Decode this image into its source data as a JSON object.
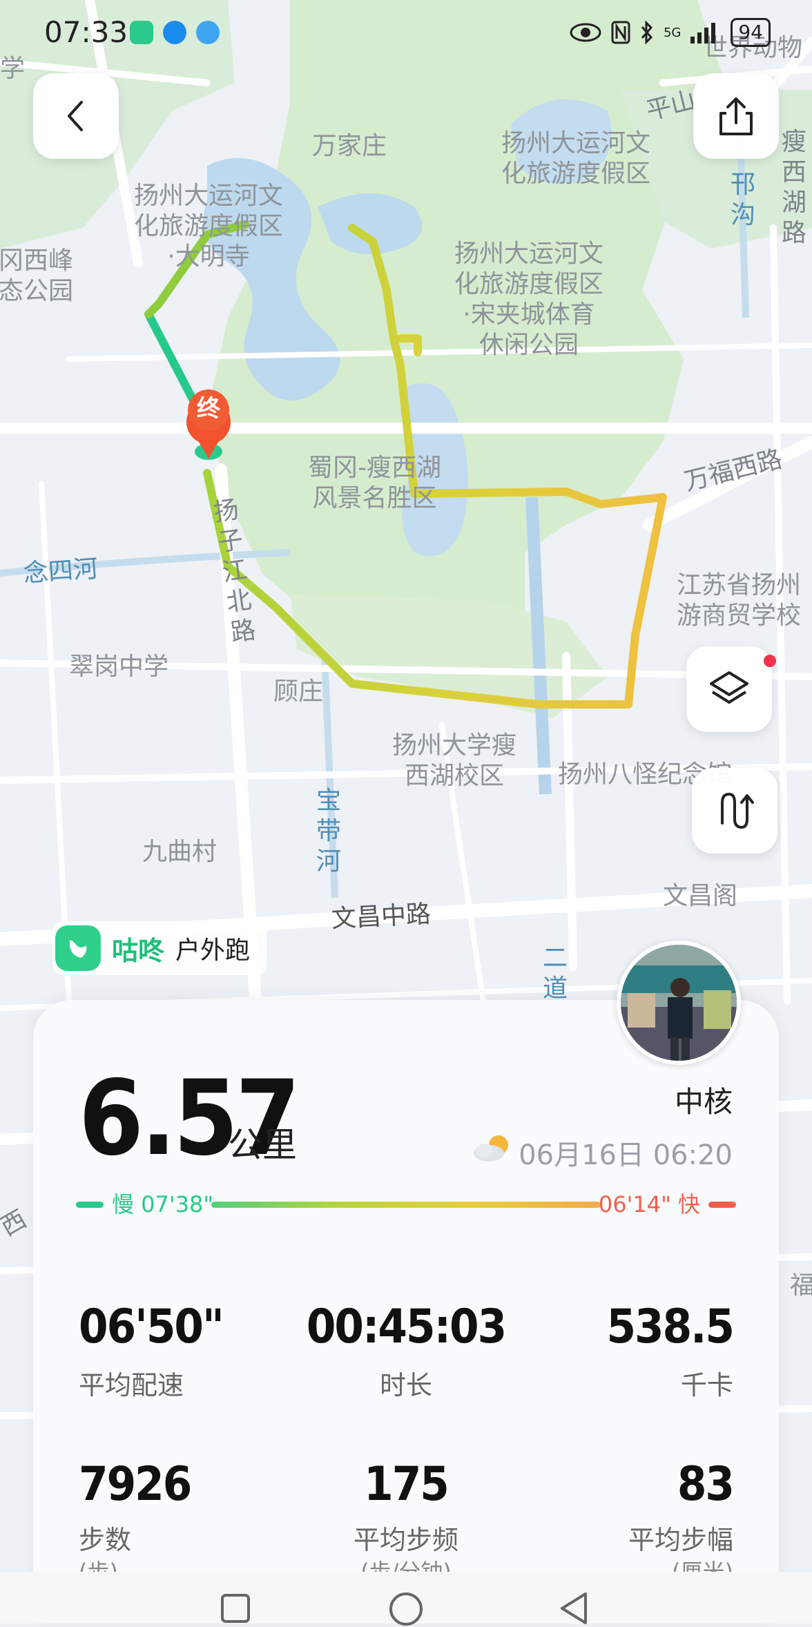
{
  "status_bar": {
    "time": "07:33",
    "battery": "94",
    "network": "5G"
  },
  "map": {
    "labels": [
      {
        "text": "万家庄",
        "kind": "place"
      },
      {
        "text": "扬州大运河文\n化旅游度假区",
        "kind": "place"
      },
      {
        "text": "扬州大运河文\n化旅游度假区\n·大明寺",
        "kind": "place"
      },
      {
        "text": "扬州大运河文\n化旅游度假区\n·宋夹城体育\n休闲公园",
        "kind": "place"
      },
      {
        "text": "冈西峰\n态公园",
        "kind": "place"
      },
      {
        "text": "蜀冈-瘦西湖\n风景名胜区",
        "kind": "place"
      },
      {
        "text": "万福西路",
        "kind": "road"
      },
      {
        "text": "念四河",
        "kind": "water"
      },
      {
        "text": "邗\n沟",
        "kind": "water"
      },
      {
        "text": "瘦\n西\n湖\n路",
        "kind": "road"
      },
      {
        "text": "平山",
        "kind": "road"
      },
      {
        "text": "扬子江北路",
        "kind": "road"
      },
      {
        "text": "翠岗中学",
        "kind": "place"
      },
      {
        "text": "顾庄",
        "kind": "place"
      },
      {
        "text": "江苏省扬州\n游商贸学校",
        "kind": "place"
      },
      {
        "text": "扬州大学瘦\n西湖校区",
        "kind": "place"
      },
      {
        "text": "扬州八怪纪念馆",
        "kind": "place"
      },
      {
        "text": "宝\n带\n河",
        "kind": "water"
      },
      {
        "text": "九曲村",
        "kind": "place"
      },
      {
        "text": "文昌阁",
        "kind": "place"
      },
      {
        "text": "文昌中路",
        "kind": "road"
      },
      {
        "text": "二\n道",
        "kind": "water"
      },
      {
        "text": "世界动物",
        "kind": "place"
      },
      {
        "text": "学",
        "kind": "place"
      },
      {
        "text": "西",
        "kind": "road"
      },
      {
        "text": "福",
        "kind": "place"
      }
    ],
    "end_marker": "终",
    "controls": {
      "back_icon": "chevron-left-icon",
      "share_icon": "share-icon",
      "layers_icon": "layers-icon",
      "route_icon": "route-icon"
    },
    "route_colors": [
      "#26c98c",
      "#a5d33a",
      "#d8d23a",
      "#f2c94c",
      "#f0b24a"
    ]
  },
  "brand": {
    "name": "咕咚",
    "sport": "户外跑",
    "color": "#2fd08b"
  },
  "summary": {
    "distance": "6.57",
    "unit": "公里",
    "user_name": "中核",
    "date": "06月16日 06:20",
    "pace_slow_label": "慢 07'38\"",
    "pace_fast_label": "06'14\" 快"
  },
  "stats": [
    {
      "value": "06'50\"",
      "label": "平均配速",
      "sub": ""
    },
    {
      "value": "00:45:03",
      "label": "时长",
      "sub": ""
    },
    {
      "value": "538.5",
      "label": "千卡",
      "sub": ""
    },
    {
      "value": "7926",
      "label": "步数",
      "sub": "(步)"
    },
    {
      "value": "175",
      "label": "平均步频",
      "sub": "(步/分钟)"
    },
    {
      "value": "83",
      "label": "平均步幅",
      "sub": "(厘米)"
    }
  ]
}
